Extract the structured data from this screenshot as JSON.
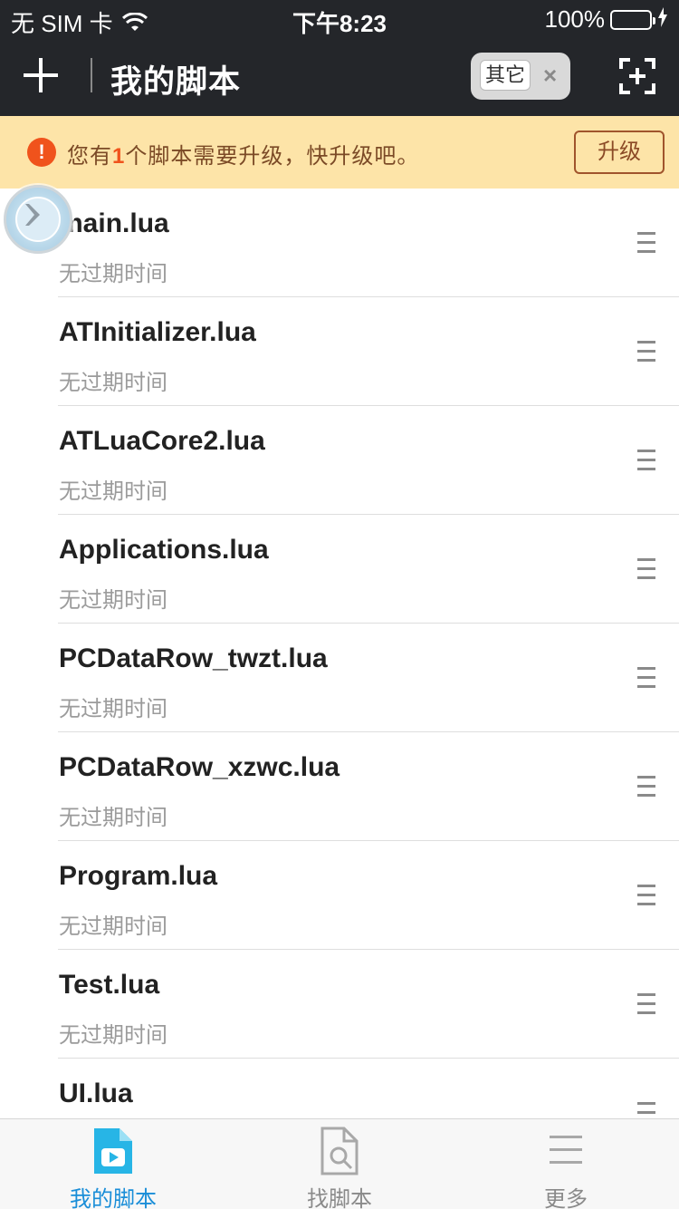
{
  "status_bar": {
    "carrier": "无 SIM 卡",
    "time": "下午8:23",
    "battery": "100%",
    "battery_level": 100
  },
  "nav": {
    "title": "我的脚本",
    "filter_chip_label": "其它",
    "filter_chip_close": "×"
  },
  "notice": {
    "icon": "!",
    "text_before": "您有",
    "count": "1",
    "text_after": "个脚本需要升级，快升级吧。",
    "button_label": "升级"
  },
  "scripts": [
    {
      "name": "main.lua",
      "expiry": "无过期时间"
    },
    {
      "name": "ATInitializer.lua",
      "expiry": "无过期时间"
    },
    {
      "name": "ATLuaCore2.lua",
      "expiry": "无过期时间"
    },
    {
      "name": "Applications.lua",
      "expiry": "无过期时间"
    },
    {
      "name": "PCDataRow_twzt.lua",
      "expiry": "无过期时间"
    },
    {
      "name": "PCDataRow_xzwc.lua",
      "expiry": "无过期时间"
    },
    {
      "name": "Program.lua",
      "expiry": "无过期时间"
    },
    {
      "name": "Test.lua",
      "expiry": "无过期时间"
    },
    {
      "name": "UI.lua",
      "expiry": ""
    }
  ],
  "tabs": [
    {
      "label": "我的脚本",
      "icon": "video-file-icon",
      "active": true
    },
    {
      "label": "找脚本",
      "icon": "file-search-icon",
      "active": false
    },
    {
      "label": "更多",
      "icon": "menu-lines-icon",
      "active": false
    }
  ],
  "colors": {
    "nav_bg": "#24262a",
    "notice_bg": "#fde4a8",
    "accent": "#1a8ed8",
    "warning": "#f0531c",
    "battery": "#4cd964"
  }
}
